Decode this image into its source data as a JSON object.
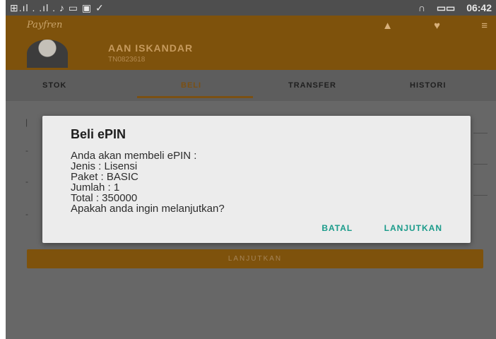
{
  "status_bar": {
    "left_icons": "⊞.ıl . .ıl . ♪ ▭ ▣ ✓",
    "headphone_icon": "∩",
    "battery_icon": "▭▭",
    "time": "06:42"
  },
  "header": {
    "brand": "Payfren",
    "user_name": "AAN ISKANDAR",
    "user_id": "TN0823618",
    "bell_icon": "▲",
    "heart_icon": "♥",
    "menu_icon": "≡"
  },
  "tabs": [
    {
      "label": "STOK",
      "active": false
    },
    {
      "label": "BELI",
      "active": true
    },
    {
      "label": "TRANSFER",
      "active": false
    },
    {
      "label": "HISTORI",
      "active": false
    }
  ],
  "main": {
    "continue_button": "LANJUTKAN"
  },
  "dialog": {
    "title": "Beli ePIN",
    "lines": [
      "Anda akan membeli ePIN :",
      "Jenis : Lisensi",
      "Paket : BASIC",
      "Jumlah : 1",
      "Total : 350000",
      "Apakah anda ingin melanjutkan?"
    ],
    "cancel_label": "BATAL",
    "confirm_label": "LANJUTKAN"
  },
  "colors": {
    "primary": "#7e520c",
    "accent": "#1a9b8a"
  }
}
